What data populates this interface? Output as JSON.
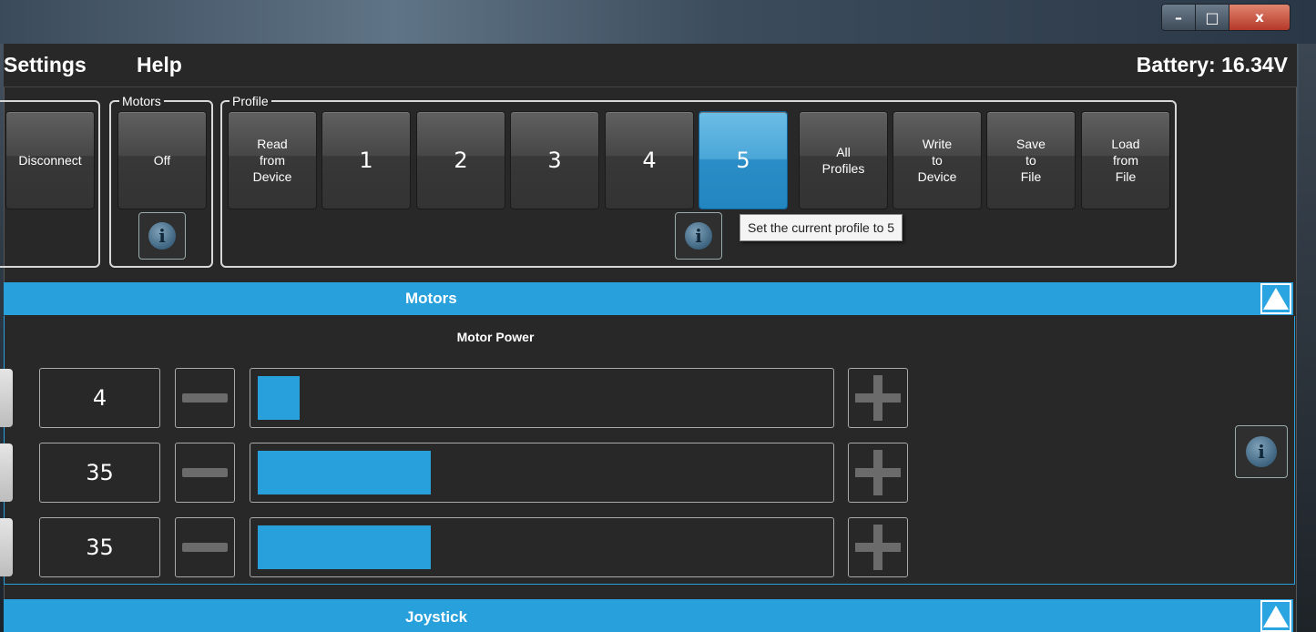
{
  "menu": {
    "items": [
      "Settings",
      "Help"
    ],
    "battery": "Battery: 16.34V"
  },
  "window": {
    "min_icon": "–",
    "max_icon": "□",
    "close_icon": "x"
  },
  "connection": {
    "disconnect": "Disconnect"
  },
  "motors_group": {
    "label": "Motors",
    "toggle": "Off"
  },
  "profile_group": {
    "label": "Profile",
    "read": "Read\nfrom\nDevice",
    "profiles": [
      "1",
      "2",
      "3",
      "4",
      "5"
    ],
    "active_profile": "5",
    "all_profiles": "All\nProfiles",
    "write": "Write\nto\nDevice",
    "save": "Save\nto\nFile",
    "load": "Load\nfrom\nFile"
  },
  "tooltip": "Set the current profile to 5",
  "info_icon": "i",
  "sections": {
    "motors": "Motors",
    "joystick": "Joystick"
  },
  "motor_power": {
    "heading": "Motor Power",
    "rows": [
      {
        "value": "4",
        "level_pct": 4
      },
      {
        "value": "35",
        "level_pct": 35
      },
      {
        "value": "35",
        "level_pct": 35
      }
    ]
  },
  "colors": {
    "accent": "#27a0db",
    "background": "#282828"
  }
}
